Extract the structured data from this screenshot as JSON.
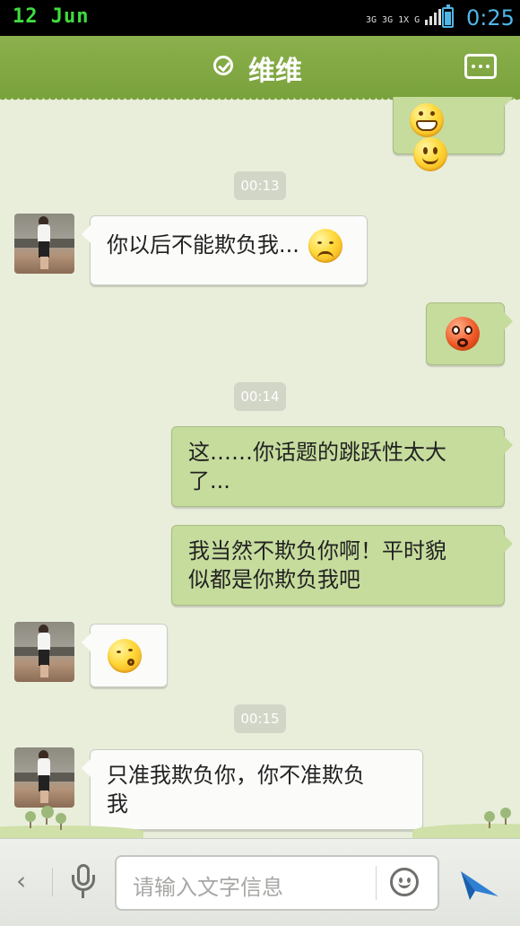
{
  "status_bar": {
    "date": "12 Jun",
    "network": [
      "3G",
      "3G 1X",
      "G"
    ],
    "time": "0:25"
  },
  "header": {
    "title": "维维",
    "verified_icon": "check-circle-icon",
    "menu_icon": "more-menu-icon"
  },
  "messages": [
    {
      "type": "outgoing",
      "content": "emoji",
      "emojis": [
        "grin",
        "smile"
      ]
    },
    {
      "type": "timestamp",
      "text": "00:13"
    },
    {
      "type": "incoming",
      "text": "你以后不能欺负我...",
      "emojis": [
        "shy"
      ]
    },
    {
      "type": "outgoing",
      "content": "emoji",
      "emojis": [
        "angry-red"
      ]
    },
    {
      "type": "timestamp",
      "text": "00:14"
    },
    {
      "type": "outgoing",
      "text": "这……你话题的跳跃性太大了..."
    },
    {
      "type": "outgoing",
      "text": "我当然不欺负你啊！平时貌似都是你欺负我吧"
    },
    {
      "type": "incoming",
      "content": "emoji",
      "emojis": [
        "kiss"
      ]
    },
    {
      "type": "timestamp",
      "text": "00:15"
    },
    {
      "type": "incoming",
      "text": "只准我欺负你，你不准欺负我"
    }
  ],
  "timestamps": [
    "00:13",
    "00:14",
    "00:15"
  ],
  "texts": {
    "m1": "你以后不能欺负我...",
    "m2_line1": "这……你话题的跳跃性太大",
    "m2_line2": "了...",
    "m3_line1": "我当然不欺负你啊！平时貌",
    "m3_line2": "似都是你欺负我吧",
    "m4_line1": "只准我欺负你，你不准欺负",
    "m4_line2": "我"
  },
  "input": {
    "placeholder": "请输入文字信息",
    "back_icon": "chevron-left-icon",
    "voice_icon": "microphone-icon",
    "emoji_icon": "smiley-icon",
    "send_icon": "send-icon"
  },
  "colors": {
    "header": "#7fa640",
    "chat_background": "#e9eedb",
    "outgoing_bubble": "#c6dc9d",
    "incoming_bubble": "#fbfbfa",
    "status_time": "#4fb7e8",
    "status_date": "#3fdc3f"
  }
}
